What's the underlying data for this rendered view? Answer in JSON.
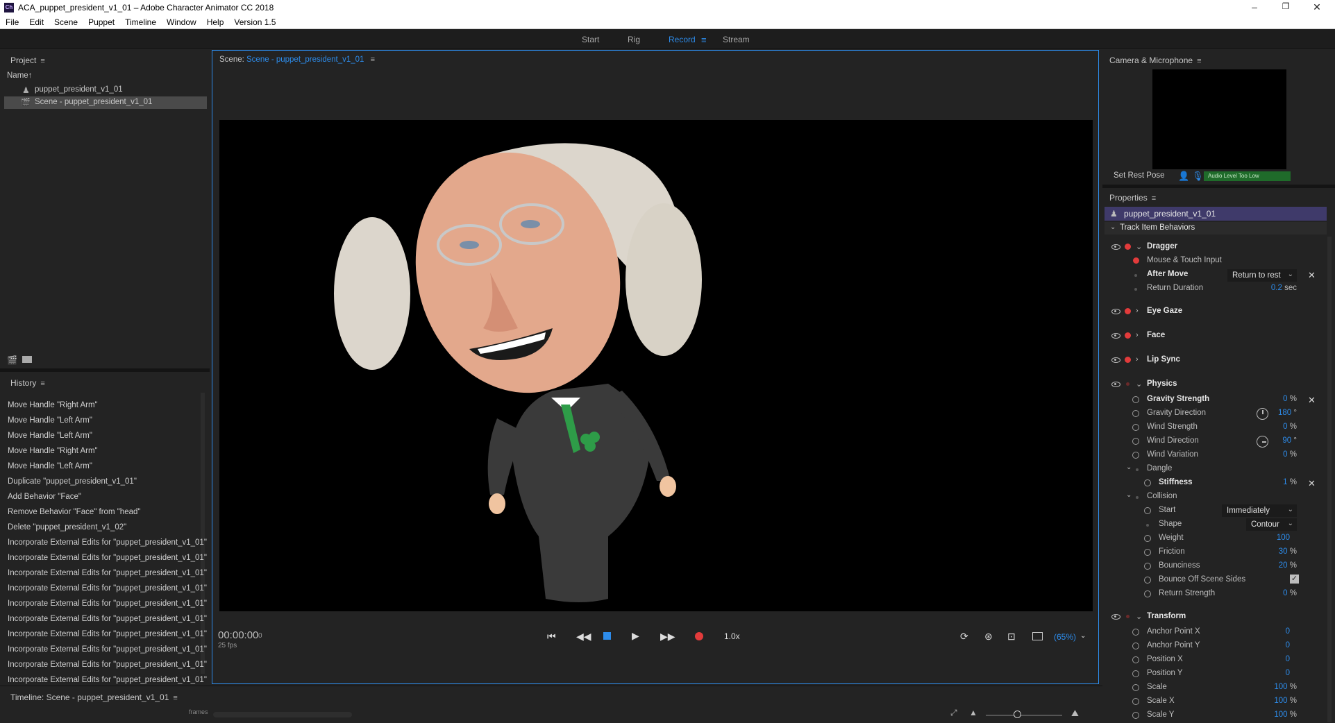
{
  "window": {
    "title": "ACA_puppet_president_v1_01 – Adobe Character Animator CC 2018",
    "app_icon": "Ch",
    "controls": [
      "–",
      "❐",
      "✕"
    ]
  },
  "menu": [
    "File",
    "Edit",
    "Scene",
    "Puppet",
    "Timeline",
    "Window",
    "Help",
    "Version 1.5"
  ],
  "workspace_tabs": [
    {
      "label": "Start",
      "active": false
    },
    {
      "label": "Rig",
      "active": false
    },
    {
      "label": "Record",
      "active": true
    },
    {
      "label": "Stream",
      "active": false
    }
  ],
  "project": {
    "title": "Project",
    "column": "Name",
    "sort_arrow": "↑",
    "items": [
      {
        "label": "puppet_president_v1_01",
        "icon": "puppet-icon",
        "selected": false
      },
      {
        "label": "Scene - puppet_president_v1_01",
        "icon": "scene-icon",
        "selected": true
      }
    ]
  },
  "history": {
    "title": "History",
    "items": [
      "Move Handle \"Right Arm\"",
      "Move Handle \"Left Arm\"",
      "Move Handle \"Left Arm\"",
      "Move Handle \"Right Arm\"",
      "Move Handle \"Left Arm\"",
      "Duplicate \"puppet_president_v1_01\"",
      "Add Behavior \"Face\"",
      "Remove Behavior \"Face\" from \"head\"",
      "Delete \"puppet_president_v1_02\"",
      "Incorporate External Edits for \"puppet_president_v1_01\"",
      "Incorporate External Edits for \"puppet_president_v1_01\"",
      "Incorporate External Edits for \"puppet_president_v1_01\"",
      "Incorporate External Edits for \"puppet_president_v1_01\"",
      "Incorporate External Edits for \"puppet_president_v1_01\"",
      "Incorporate External Edits for \"puppet_president_v1_01\"",
      "Incorporate External Edits for \"puppet_president_v1_01\"",
      "Incorporate External Edits for \"puppet_president_v1_01\"",
      "Incorporate External Edits for \"puppet_president_v1_01\"",
      "Incorporate External Edits for \"puppet_president_v1_01\""
    ]
  },
  "timeline": {
    "title": "Timeline: Scene - puppet_president_v1_01",
    "frames_label": "frames"
  },
  "scene": {
    "prefix": "Scene:",
    "name": "Scene - puppet_president_v1_01",
    "timecode": "00:00:00",
    "frame": "0",
    "fps": "25 fps",
    "speed": "1.0x",
    "zoom": "(65%)"
  },
  "camera": {
    "title": "Camera & Microphone",
    "set_rest_pose": "Set Rest Pose",
    "audio_status": "Audio Level Too Low"
  },
  "properties": {
    "title": "Properties",
    "puppet_name": "puppet_president_v1_01",
    "section": "Track Item Behaviors",
    "dragger": {
      "label": "Dragger",
      "mouse_touch": "Mouse & Touch Input",
      "after_move_label": "After Move",
      "after_move_value": "Return to rest",
      "return_duration_label": "Return Duration",
      "return_duration_value": "0.2",
      "return_duration_unit": "sec"
    },
    "eye_gaze": "Eye Gaze",
    "face": "Face",
    "lip_sync": "Lip Sync",
    "physics": {
      "label": "Physics",
      "gravity_strength": {
        "label": "Gravity Strength",
        "value": "0",
        "unit": "%"
      },
      "gravity_direction": {
        "label": "Gravity Direction",
        "value": "180",
        "unit": "°"
      },
      "wind_strength": {
        "label": "Wind Strength",
        "value": "0",
        "unit": "%"
      },
      "wind_direction": {
        "label": "Wind Direction",
        "value": "90",
        "unit": "°"
      },
      "wind_variation": {
        "label": "Wind Variation",
        "value": "0",
        "unit": "%"
      },
      "dangle": "Dangle",
      "stiffness": {
        "label": "Stiffness",
        "value": "1",
        "unit": "%"
      },
      "collision": "Collision",
      "start": {
        "label": "Start",
        "value": "Immediately"
      },
      "shape": {
        "label": "Shape",
        "value": "Contour"
      },
      "weight": {
        "label": "Weight",
        "value": "100"
      },
      "friction": {
        "label": "Friction",
        "value": "30",
        "unit": "%"
      },
      "bounciness": {
        "label": "Bounciness",
        "value": "20",
        "unit": "%"
      },
      "bounce_off": {
        "label": "Bounce Off Scene Sides",
        "checked": true
      },
      "return_strength": {
        "label": "Return Strength",
        "value": "0",
        "unit": "%"
      }
    },
    "transform": {
      "label": "Transform",
      "anchor_x": {
        "label": "Anchor Point X",
        "value": "0"
      },
      "anchor_y": {
        "label": "Anchor Point Y",
        "value": "0"
      },
      "position_x": {
        "label": "Position X",
        "value": "0"
      },
      "position_y": {
        "label": "Position Y",
        "value": "0"
      },
      "scale": {
        "label": "Scale",
        "value": "100",
        "unit": "%"
      },
      "scale_x": {
        "label": "Scale X",
        "value": "100",
        "unit": "%"
      },
      "scale_y": {
        "label": "Scale Y",
        "value": "100",
        "unit": "%"
      }
    }
  },
  "colors": {
    "accent": "#2d8ceb",
    "record": "#e23b3b",
    "panel": "#232323",
    "stage": "#000000",
    "audio_meter": "#1f6b2a"
  }
}
